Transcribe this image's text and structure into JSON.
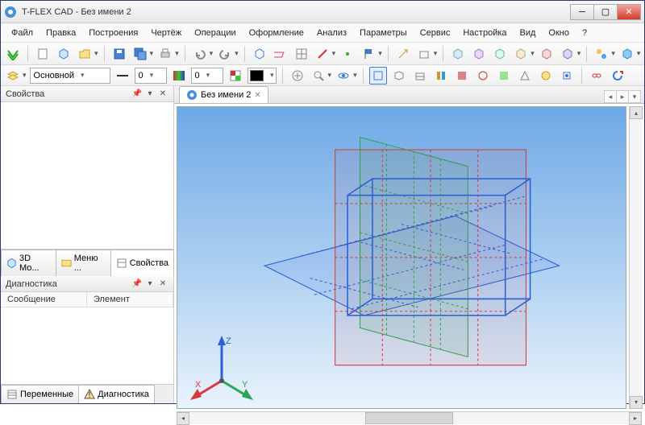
{
  "window": {
    "title": "T-FLEX CAD - Без имени 2"
  },
  "menu": [
    "Файл",
    "Правка",
    "Построения",
    "Чертёж",
    "Операции",
    "Оформление",
    "Анализ",
    "Параметры",
    "Сервис",
    "Настройка",
    "Вид",
    "Окно",
    "?"
  ],
  "layerbar": {
    "layer": "Основной",
    "num1": "0",
    "num2": "0"
  },
  "panes": {
    "properties": {
      "title": "Свойства"
    },
    "diagnostics": {
      "title": "Диагностика",
      "columns": [
        "Сообщение",
        "Элемент"
      ]
    }
  },
  "left_tabs_top": [
    "3D Мо...",
    "Меню ...",
    "Свойства"
  ],
  "left_tabs_bottom": [
    "Переменные",
    "Диагностика"
  ],
  "document": {
    "tab": "Без имени 2"
  },
  "axes": {
    "x": "X",
    "y": "Y",
    "z": "Z"
  }
}
